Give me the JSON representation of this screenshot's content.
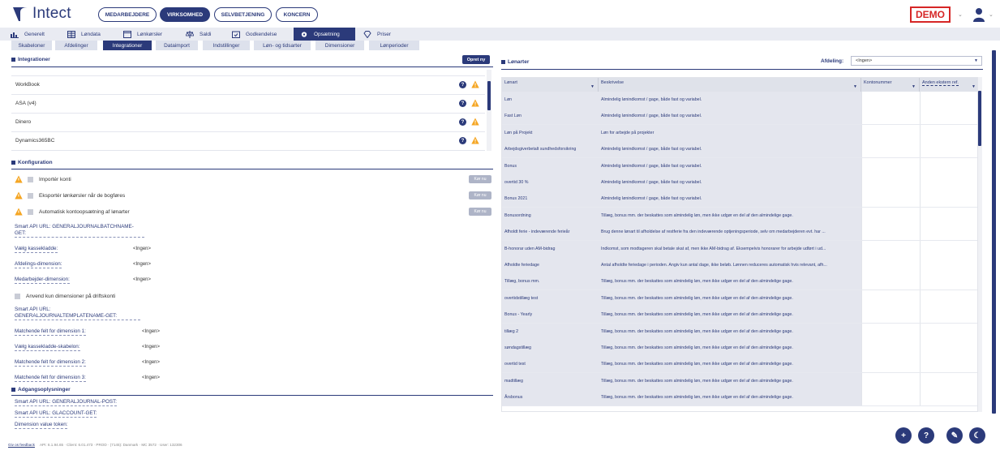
{
  "app": {
    "name": "Intect"
  },
  "header": {
    "pills": [
      {
        "label": "MEDARBEJDERE",
        "active": false
      },
      {
        "label": "VIRKSOMHED",
        "active": true
      },
      {
        "label": "SELVBETJENING",
        "active": false
      },
      {
        "label": "KONCERN",
        "active": false
      }
    ],
    "demo_label": "DEMO"
  },
  "mainnav": [
    {
      "label": "Generelt",
      "icon": "bar-chart-icon"
    },
    {
      "label": "Løndata",
      "icon": "grid-icon"
    },
    {
      "label": "Lønkørsler",
      "icon": "window-icon"
    },
    {
      "label": "Saldi",
      "icon": "scale-icon"
    },
    {
      "label": "Godkendelse",
      "icon": "calendar-check-icon"
    },
    {
      "label": "Opsætning",
      "icon": "gear-icon",
      "active": true
    },
    {
      "label": "Priser",
      "icon": "diamond-icon"
    }
  ],
  "subnav": [
    {
      "label": "Skabeloner"
    },
    {
      "label": "Afdelinger"
    },
    {
      "label": "Integrationer",
      "active": true
    },
    {
      "label": "Dataimport"
    },
    {
      "label": "Indstillinger"
    },
    {
      "label": "Løn- og tidsarter"
    },
    {
      "label": "Dimensioner"
    },
    {
      "label": "Lønperioder"
    }
  ],
  "integrations": {
    "title": "Integrationer",
    "create_button": "Opret ny",
    "items": [
      "WorkBook",
      "ASA (v4)",
      "Dinero",
      "Dynamics365BC"
    ]
  },
  "config": {
    "title": "Konfiguration",
    "run_label": "Kør nu",
    "options": [
      "Importér konti",
      "Eksportér lønkørsler når de bogføres",
      "Automatisk kontoopsætning af lønarter"
    ],
    "fields": {
      "smart_batch": "Smart API URL: GENERALJOURNALBATCHNAME-GET:",
      "cashbook_label": "Vælg kassekladde:",
      "cashbook_value": "<Ingen>",
      "dept_label": "Afdelings-dimension:",
      "dept_value": "<Ingen>",
      "emp_label": "Medarbejder-dimension:",
      "emp_value": "<Ingen>",
      "apply_only": "Anvend kun dimensioner på driftskonti",
      "smart_template": "Smart API URL: GENERALJOURNALTEMPLATENAME-GET:",
      "match1_label": "Matchende felt for dimension 1:",
      "match1_value": "<Ingen>",
      "template_label": "Vælg kassekladde-skabelon:",
      "template_value": "<Ingen>",
      "match2_label": "Matchende felt for dimension 2:",
      "match2_value": "<Ingen>",
      "match3_label": "Matchende felt for dimension 3:",
      "match3_value": "<Ingen>"
    }
  },
  "access": {
    "title": "Adgangsoplysninger",
    "fields": [
      "Smart API URL: GENERALJOURNAL-POST:",
      "Smart API URL: GLACCOUNT-GET:",
      "Dimension value token:"
    ]
  },
  "wagetypes": {
    "title": "Lønarter",
    "dept_label": "Afdeling:",
    "dept_value": "<Ingen>",
    "columns": [
      "Lønart",
      "Beskrivelse",
      "Kontonummer",
      "Anden ekstern ref."
    ],
    "rows": [
      [
        "Løn",
        "Almindelig lønindkomst / gage, både fast og variabel."
      ],
      [
        "Fast Løn",
        "Almindelig lønindkomst / gage, både fast og variabel."
      ],
      [
        "Løn på Projekt",
        "Løn for arbejde på projekter"
      ],
      [
        "Arbejdsgiverbetalt sundhedsforsikring",
        "Almindelig lønindkomst / gage, både fast og variabel."
      ],
      [
        "Bonus",
        "Almindelig lønindkomst / gage, både fast og variabel."
      ],
      [
        "overtid 30 %",
        "Almindelig lønindkomst / gage, både fast og variabel."
      ],
      [
        "Bonus 2021",
        "Almindelig lønindkomst / gage, både fast og variabel."
      ],
      [
        "Bonusordning",
        "Tillæg, bonus mm. der beskattes som almindelig løn, men ikke udgør en del af den almindelige gage."
      ],
      [
        "Afholdt ferie - indeværende ferieår",
        "Brug denne lønart til afholdelse af restferie fra den indeværende optjeningsperiode, selv om medarbejderen evt. har ..."
      ],
      [
        "B-honorar uden AM-bidrag",
        "Indkomst, som modtageren skal betale skat af, men ikke AM-bidrag af. Eksempelvis honorarer for arbejde udført i ud..."
      ],
      [
        "Afholdte feriedage",
        "Antal afholdte feriedage i perioden. Angiv kun antal dage, ikke beløb. Lønnen reduceres automatisk hvis relevant, afh..."
      ],
      [
        "Tillæg, bonus mm.",
        "Tillæg, bonus mm. der beskattes som almindelig løn, men ikke udgør en del af den almindelige gage."
      ],
      [
        "overtidstillæg test",
        "Tillæg, bonus mm. der beskattes som almindelig løn, men ikke udgør en del af den almindelige gage."
      ],
      [
        "Bonus - Yearly",
        "Tillæg, bonus mm. der beskattes som almindelig løn, men ikke udgør en del af den almindelige gage."
      ],
      [
        "tillæg 2",
        "Tillæg, bonus mm. der beskattes som almindelig løn, men ikke udgør en del af den almindelige gage."
      ],
      [
        "søndagstillæg",
        "Tillæg, bonus mm. der beskattes som almindelig løn, men ikke udgør en del af den almindelige gage."
      ],
      [
        "overtid test",
        "Tillæg, bonus mm. der beskattes som almindelig løn, men ikke udgør en del af den almindelige gage."
      ],
      [
        "madtillæg",
        "Tillæg, bonus mm. der beskattes som almindelig løn, men ikke udgør en del af den almindelige gage."
      ],
      [
        "Årsbonus",
        "Tillæg, bonus mm. der beskattes som almindelig løn, men ikke udgør en del af den almindelige gage."
      ]
    ]
  },
  "footer": {
    "feedback": "Giv os feedback",
    "info": "API: 6.1.94.65 · Client: 6.01.473 · PROD · (7145): Danmark · MC 3572 · User: 132306"
  },
  "fabs": [
    "+",
    "?",
    "✎",
    "☾"
  ],
  "colors": {
    "navy": "#2b3a7a",
    "warning": "#f5a623",
    "demo_red": "#d62626"
  }
}
